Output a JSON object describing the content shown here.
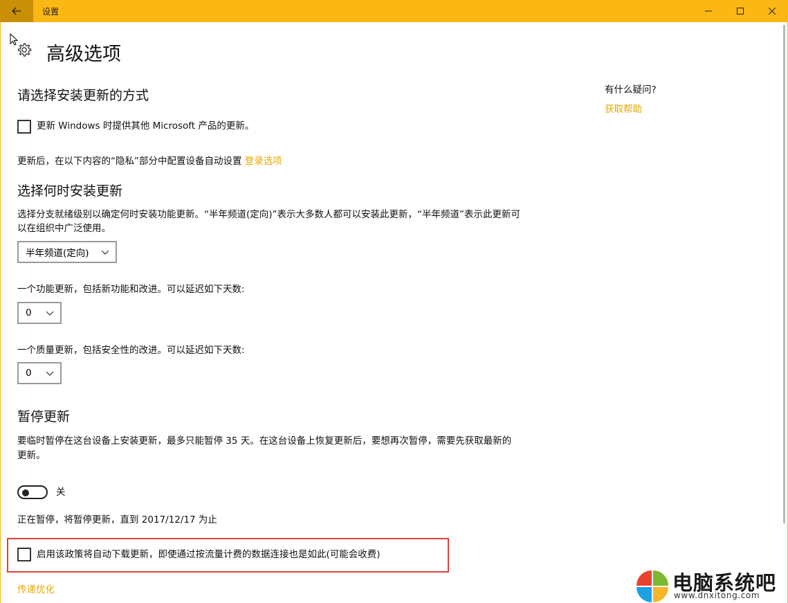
{
  "window": {
    "title": "设置",
    "accent_color": "#fbb714",
    "back_icon": "back-arrow-icon",
    "controls": [
      "minimize-icon",
      "maximize-icon",
      "close-icon"
    ]
  },
  "page": {
    "title": "高级选项",
    "icon": "gear-icon"
  },
  "install_method": {
    "heading": "请选择安装更新的方式",
    "checkbox_label": "更新 Windows 时提供其他 Microsoft 产品的更新。",
    "checkbox_checked": false,
    "privacy_text": "更新后，在以下内容的“隐私”部分中配置设备自动设置",
    "privacy_link": "登录选项"
  },
  "when_install": {
    "heading": "选择何时安装更新",
    "description_line1": "选择分支就绪级别以确定何时安装功能更新。“半年频道(定向)”表示大多数人都可以安装此更新，“半年频道”表示此更新可",
    "description_line2": "以在组织中广泛使用。",
    "channel_value": "半年频道(定向)",
    "feature_label": "一个功能更新，包括新功能和改进。可以延迟如下天数:",
    "feature_value": "0",
    "quality_label": "一个质量更新，包括安全性的改进。可以延迟如下天数:",
    "quality_value": "0"
  },
  "pause": {
    "heading": "暂停更新",
    "description_line1": "要临时暂停在这台设备上安装更新，最多只能暂停 35 天。在这台设备上恢复更新后，要想再次暂停，需要先获取最新的",
    "description_line2": "更新。",
    "toggle_state": "关",
    "toggle_on": false,
    "status_text": "正在暂停，将暂停更新，直到 2017/12/17 为止"
  },
  "metered": {
    "checkbox_label": "启用该政策将自动下载更新，即使通过按流量计费的数据连接也是如此(可能会收费)",
    "checkbox_checked": false,
    "highlight_color": "#e0403a"
  },
  "delivery": {
    "link": "传递优化"
  },
  "help": {
    "question": "有什么疑问?",
    "link": "获取帮助"
  },
  "watermark": {
    "name": "电脑系统吧",
    "url": "www.dnxitong.com"
  }
}
